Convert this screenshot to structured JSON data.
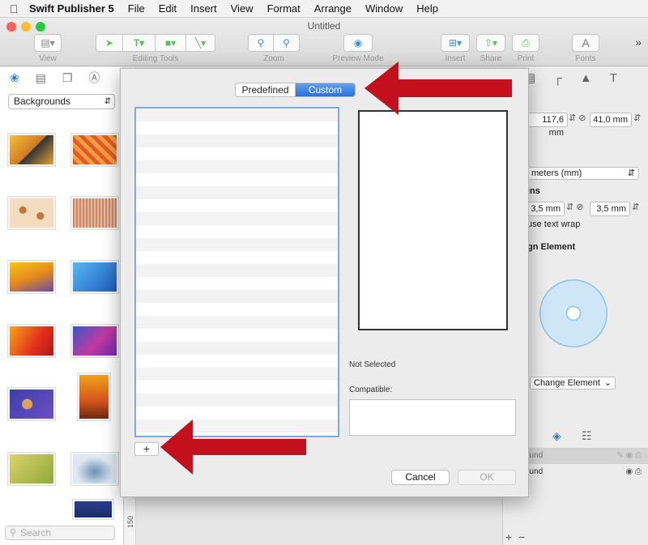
{
  "menubar": {
    "app_name": "Swift Publisher 5",
    "items": [
      "File",
      "Edit",
      "Insert",
      "View",
      "Format",
      "Arrange",
      "Window",
      "Help"
    ]
  },
  "window": {
    "title": "Untitled"
  },
  "toolbar": {
    "labels": {
      "view": "View",
      "editing_tools": "Editing Tools",
      "zoom": "Zoom",
      "preview_mode": "Preview Mode",
      "insert": "Insert",
      "share": "Share",
      "print": "Print",
      "fonts": "Fonts"
    },
    "overflow": "»"
  },
  "sidebar": {
    "category": "Backgrounds",
    "search_placeholder": "Search"
  },
  "ruler": {
    "label": "150"
  },
  "inspector": {
    "width_value": "117,6 mm",
    "height_value": "41,0 mm",
    "units_value": "meters (mm)",
    "margins_label": "ins",
    "margin_left": "3,5 mm",
    "margin_right": "3,5 mm",
    "text_wrap_label": "use text wrap",
    "design_element_label": "gn Element",
    "change_element": "Change Element",
    "layers": [
      "ound",
      "ound"
    ]
  },
  "dialog": {
    "tabs": {
      "predefined": "Predefined",
      "custom": "Custom"
    },
    "status": "Not Selected",
    "compatible_label": "Compatible:",
    "add_button": "+",
    "cancel_button": "Cancel",
    "ok_button": "OK"
  },
  "colors": {
    "accent": "#2c6fd8",
    "arrow": "#c4101c",
    "list_focus": "#7ea8e6"
  }
}
